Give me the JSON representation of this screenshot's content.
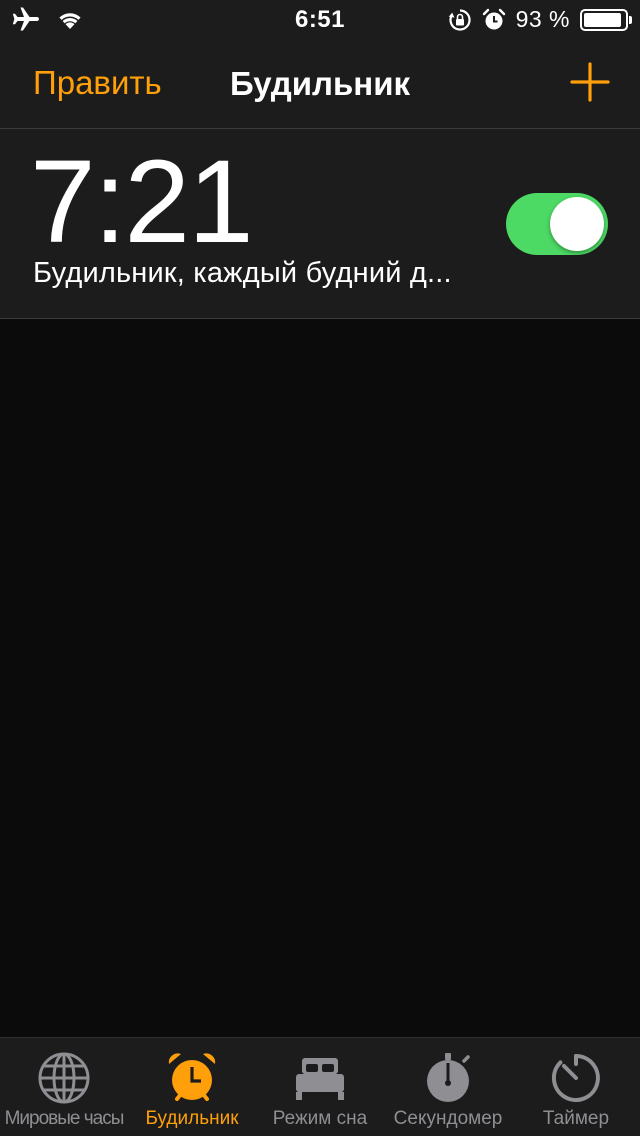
{
  "status_bar": {
    "time": "6:51",
    "battery_percent": "93 %",
    "battery_level": 0.93,
    "icons": [
      "airplane-icon",
      "wifi-icon",
      "orientation-lock-icon",
      "alarm-icon",
      "battery-icon"
    ]
  },
  "nav": {
    "edit_label": "Править",
    "title": "Будильник",
    "add_icon": "plus-icon"
  },
  "alarm": {
    "time": "7:21",
    "label": "Будильник, каждый будний д...",
    "enabled": true
  },
  "tabs": [
    {
      "label": "Мировые часы",
      "icon": "globe-icon",
      "active": false
    },
    {
      "label": "Будильник",
      "icon": "alarm-clock-icon",
      "active": true
    },
    {
      "label": "Режим сна",
      "icon": "bed-icon",
      "active": false
    },
    {
      "label": "Секундомер",
      "icon": "stopwatch-icon",
      "active": false
    },
    {
      "label": "Таймер",
      "icon": "timer-icon",
      "active": false
    }
  ],
  "colors": {
    "accent": "#ff9f0a",
    "toggle_on": "#4cd964",
    "background": "#0b0b0b",
    "bar_background": "#1c1c1c",
    "inactive": "#8e8e93"
  }
}
